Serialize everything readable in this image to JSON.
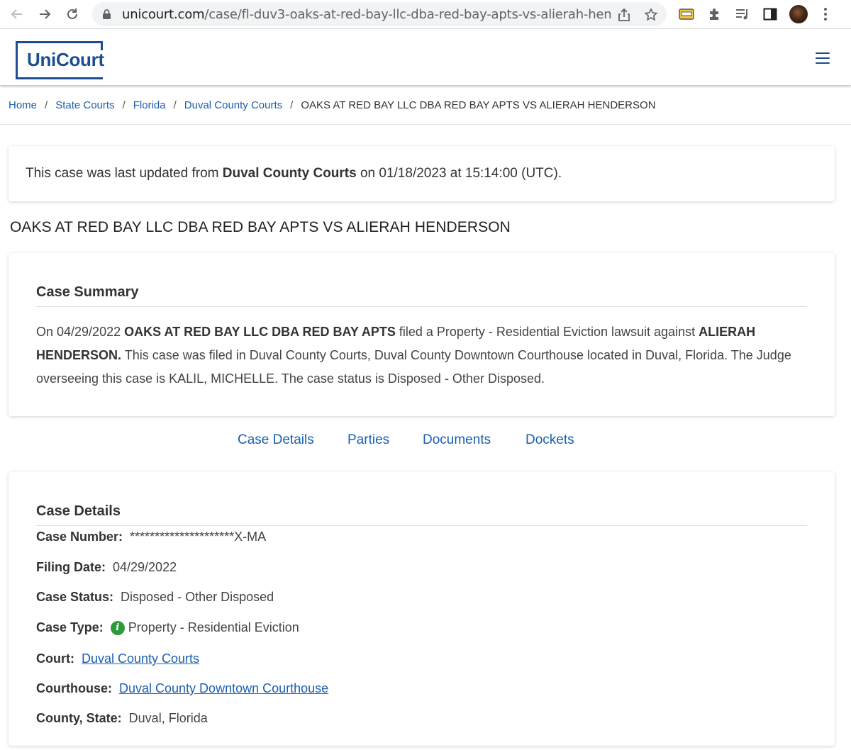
{
  "browser": {
    "url_host": "unicourt.com",
    "url_path": "/case/fl-duv3-oaks-at-red-bay-llc-dba-red-bay-apts-vs-alierah-hen..."
  },
  "header": {
    "logo_text": "UniCourt"
  },
  "breadcrumb": {
    "items": [
      "Home",
      "State Courts",
      "Florida",
      "Duval County Courts"
    ],
    "separator": "/",
    "current": "OAKS AT RED BAY LLC DBA RED BAY APTS VS ALIERAH HENDERSON"
  },
  "update_notice": {
    "prefix": "This case was last updated from",
    "court": "Duval County Courts",
    "suffix": "on 01/18/2023 at 15:14:00 (UTC)."
  },
  "case_title": "OAKS AT RED BAY LLC DBA RED BAY APTS VS ALIERAH HENDERSON",
  "summary": {
    "heading": "Case Summary",
    "t1": "On 04/29/2022",
    "plaintiff": "OAKS AT RED BAY LLC DBA RED BAY APTS",
    "t2": "filed a Property - Residential Eviction lawsuit against",
    "defendant": "ALIERAH HENDERSON.",
    "t3": "This case was filed in Duval County Courts, Duval County Downtown Courthouse located in Duval, Florida. The Judge overseeing this case is KALIL, MICHELLE. The case status is Disposed - Other Disposed."
  },
  "tabs": [
    "Case Details",
    "Parties",
    "Documents",
    "Dockets"
  ],
  "details": {
    "heading": "Case Details",
    "case_number_label": "Case Number:",
    "case_number": "*********************X-MA",
    "filing_date_label": "Filing Date:",
    "filing_date": "04/29/2022",
    "case_status_label": "Case Status:",
    "case_status": "Disposed - Other Disposed",
    "case_type_label": "Case Type:",
    "case_type": "Property - Residential Eviction",
    "court_label": "Court:",
    "court": "Duval County Courts",
    "courthouse_label": "Courthouse:",
    "courthouse": "Duval County Downtown Courthouse",
    "county_state_label": "County, State:",
    "county_state": "Duval, Florida"
  },
  "colors": {
    "brand": "#1b4d8f",
    "link": "#1b5fb0",
    "info_icon": "#2e9b3a"
  }
}
